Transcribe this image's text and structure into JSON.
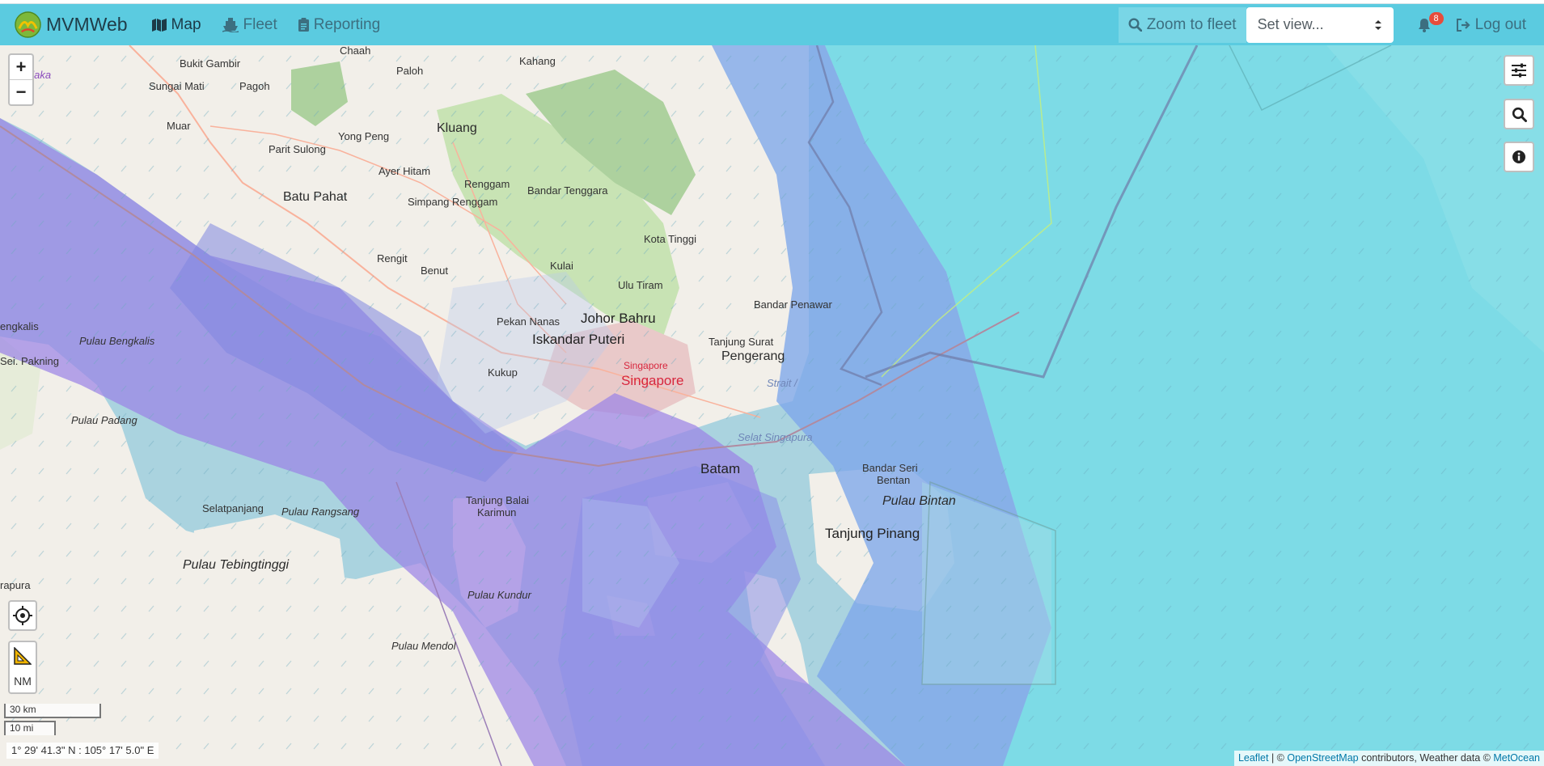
{
  "app": {
    "brand": "MVMWeb"
  },
  "nav": {
    "map": "Map",
    "fleet": "Fleet",
    "reporting": "Reporting"
  },
  "toolbar": {
    "zoom_to_fleet": "Zoom to fleet",
    "set_view": "Set view...",
    "notifications_count": "8",
    "logout": "Log out"
  },
  "map": {
    "scale_km": "30 km",
    "scale_mi": "10 mi",
    "coordinates": "1° 29' 41.3\" N : 105° 17' 5.0\" E",
    "units_label": "NM",
    "attribution": {
      "leaflet": "Leaflet",
      "sep1": " | © ",
      "osm": "OpenStreetMap",
      "mid": " contributors, Weather data © ",
      "metocean": "MetOcean"
    },
    "labels": [
      "Chaah",
      "Kahang",
      "Bukit Gambir",
      "Paloh",
      "Sungai Mati",
      "Pagoh",
      "Muar",
      "Kluang",
      "Yong Peng",
      "Parit Sulong",
      "Ayer Hitam",
      "Renggam",
      "Bandar Tenggara",
      "Batu Pahat",
      "Simpang Renggam",
      "Kota Tinggi",
      "Rengit",
      "Benut",
      "Kulai",
      "Ulu Tiram",
      "Bandar Penawar",
      "Pekan Nanas",
      "Johor Bahru",
      "Iskandar Puteri",
      "Tanjung Surat",
      "Pengerang",
      "Singapore",
      "Kukup",
      "Singapore",
      "Strait /",
      "Selat Singapura",
      "Pulau Bengkalis",
      "engkalis",
      "Sei. Pakning",
      "Pulau Padang",
      "Batam",
      "Bandar Seri",
      "Bentan",
      "Pulau Bintan",
      "Tanjung Balai",
      "Karimun",
      "Tanjung Pinang",
      "Selatpanjang",
      "Pulau Rangsang",
      "Pulau Tebingtinggi",
      "Pulau Kundur",
      "rapura",
      "Pulau Mendol",
      "elaka"
    ]
  }
}
